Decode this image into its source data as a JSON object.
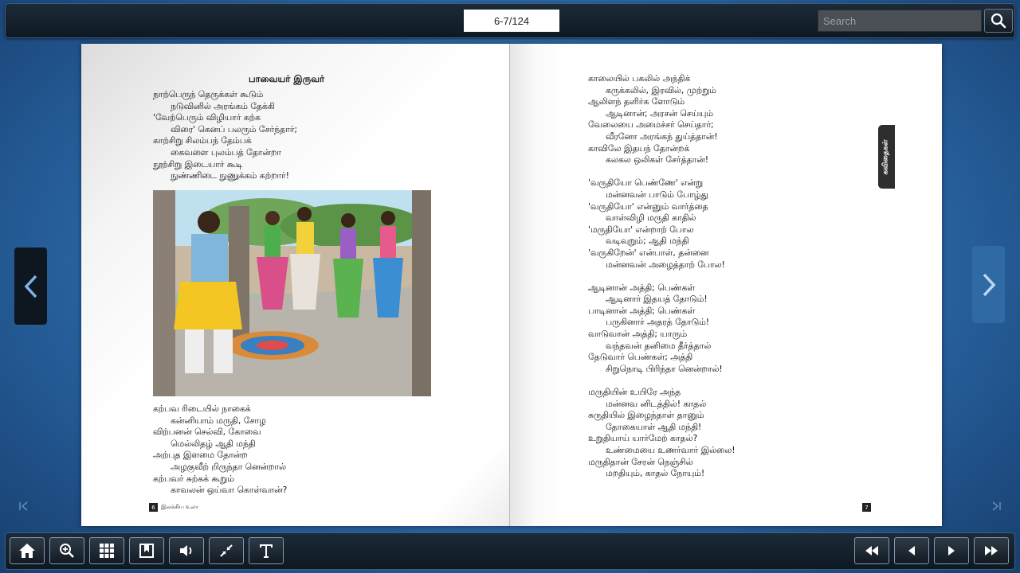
{
  "topbar": {
    "page_indicator": "6-7/124",
    "search_placeholder": "Search"
  },
  "left_page": {
    "title": "பாவையர் இருவர்",
    "verse1": [
      {
        "text": "நாற்பெருந் தெருக்கள் கூடும்",
        "indent": false
      },
      {
        "text": "நடுவினில் அரங்கம் தேக்கி",
        "indent": true
      },
      {
        "text": "'வேற்பெரும் விழியார் கற்க",
        "indent": false
      },
      {
        "text": "விரை' கெனப் பலரும் சேர்ந்தார்;",
        "indent": true
      },
      {
        "text": "காற்சிறு சிலம்பந் தேம்பக்",
        "indent": false
      },
      {
        "text": "கைவளை புலம்பத் தோன்றா",
        "indent": true
      },
      {
        "text": "நூற்சிறு இடையார் கூடி",
        "indent": false
      },
      {
        "text": "நுண்ணிடை நுணுக்கம் கற்றார்!",
        "indent": true
      }
    ],
    "verse2": [
      {
        "text": "கற்பவ ரிடையில் நாகைக்",
        "indent": false
      },
      {
        "text": "கன்னியாம் மருதி, சோழ",
        "indent": true
      },
      {
        "text": "விற்பனன் செல்வி, கோவை",
        "indent": false
      },
      {
        "text": "மெல்லிதழ் ஆதி மந்தி",
        "indent": true
      },
      {
        "text": "அற்புத இளமை தோன்ற",
        "indent": false
      },
      {
        "text": "அழகுவீற் றிருந்தா னென்றால்",
        "indent": true
      },
      {
        "text": "கற்பவர் சுற்கக் கூறும்",
        "indent": false
      },
      {
        "text": "காவலன் ஒய்வா கொள்வான்?",
        "indent": true
      }
    ],
    "page_number": "6",
    "footer_title": "இலக்கிய உலா"
  },
  "right_page": {
    "stanzas": [
      [
        {
          "text": "காலையில் பகலில் அந்திக்",
          "indent": false
        },
        {
          "text": "கருக்கலில், இரவில், முற்றும்",
          "indent": true
        },
        {
          "text": "ஆலிளந் தளிர்க ளோடும்",
          "indent": false
        },
        {
          "text": "ஆடினான்; அரசன் செய்யும்",
          "indent": true
        },
        {
          "text": "வேலையை அமைச்சர் செய்தார்;",
          "indent": false
        },
        {
          "text": "வீரனோ அரங்கந் துய்த்தான்!",
          "indent": true
        },
        {
          "text": "காவிலே இதயந் தோன்றக்",
          "indent": false
        },
        {
          "text": "கலகல ஒலிகள் சேர்த்தான்!",
          "indent": true
        }
      ],
      [
        {
          "text": "'வருதியோ பெண்ணே' என்று",
          "indent": false
        },
        {
          "text": "மன்னவன் பாடும் போழ்து",
          "indent": true
        },
        {
          "text": "'வருதியோ' என்னும் வார்த்தை",
          "indent": false
        },
        {
          "text": "வாள்விழி மருதி காதில்",
          "indent": true
        },
        {
          "text": "'மருதியோ' என்றாற் போல",
          "indent": false
        },
        {
          "text": "வடிவுறும்; ஆதி மந்தி",
          "indent": true
        },
        {
          "text": "'வருகிறேன்' என்பாள், தன்னை",
          "indent": false
        },
        {
          "text": "மன்னவன் அழைத்தாற் போல!",
          "indent": true
        }
      ],
      [
        {
          "text": "ஆடினான் அத்தி; பெண்கள்",
          "indent": false
        },
        {
          "text": "ஆடினார் இதயத் தோடும்!",
          "indent": true
        },
        {
          "text": "பாடினான் அத்தி; பெண்கள்",
          "indent": false
        },
        {
          "text": "பருகினார் அதரத் தோடும்!",
          "indent": true
        },
        {
          "text": "வாடுவான் அத்தி; யாரும்",
          "indent": false
        },
        {
          "text": "வந்தவன் தனிமை தீர்த்தால்",
          "indent": true
        },
        {
          "text": "தேடுவார் பெண்கள்; அத்தி",
          "indent": false
        },
        {
          "text": "சிறுநொடி பிரிந்தா னென்றால்!",
          "indent": true
        }
      ],
      [
        {
          "text": "மருதியின் உயிரே அந்த",
          "indent": false
        },
        {
          "text": "மன்னவ னிடத்தில்! காதல்",
          "indent": true
        },
        {
          "text": "சுருதியில் இழைந்தாள் தானும்",
          "indent": false
        },
        {
          "text": "தோகையாள் ஆதி மந்தி!",
          "indent": true
        },
        {
          "text": "உறுதியாய் யார்மேற் காதல்?",
          "indent": false
        },
        {
          "text": "உண்மையை உணர்வார் இல்லை!",
          "indent": true
        },
        {
          "text": "மருதிதான் சேரன் நெஞ்சில்",
          "indent": false
        },
        {
          "text": "மறதியும், காதல் நோயும்!",
          "indent": true
        }
      ]
    ],
    "page_number": "7",
    "side_tab": "கவிதைகள்"
  },
  "toolbar": {
    "left_buttons": [
      "home-icon",
      "zoom-in-icon",
      "grid-icon",
      "bookmark-icon",
      "sound-icon",
      "fullscreen-exit-icon",
      "text-icon"
    ],
    "right_buttons": [
      "first-page-icon",
      "previous-page-icon",
      "next-page-icon",
      "last-page-icon"
    ]
  },
  "colors": {
    "background": "#2f6faf",
    "bar": "#0e1822",
    "nav_next": "#2f6aa4"
  }
}
